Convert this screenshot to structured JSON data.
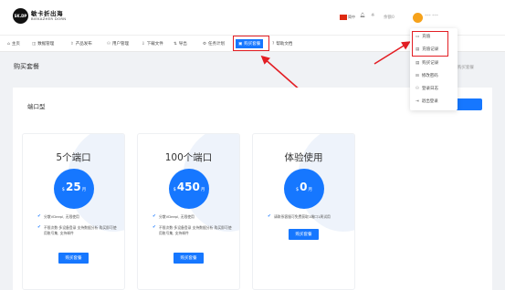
{
  "brand": {
    "logo_mark": "SK.DP",
    "name_cn": "敏卡折出海",
    "name_en": "BIEKAZHER DORN"
  },
  "header_tools": {
    "flag_label": "简中",
    "bell_icon": "bell-icon",
    "theme_icon": "brightness-icon",
    "account_text": "余额0",
    "username": "*** ***"
  },
  "nav": [
    {
      "icon": "⌂",
      "label": "主页"
    },
    {
      "icon": "◫",
      "label": "数据管理"
    },
    {
      "icon": "⇧",
      "label": "产品发布"
    },
    {
      "icon": "⚇",
      "label": "用户管理"
    },
    {
      "icon": "⇩",
      "label": "下载文件"
    },
    {
      "icon": "⇅",
      "label": "导出"
    },
    {
      "icon": "⚙",
      "label": "任务计划"
    },
    {
      "icon": "▣",
      "label": "购买套餐"
    },
    {
      "icon": "?",
      "label": "帮助文档"
    }
  ],
  "dropdown": [
    {
      "icon": "▭",
      "label": "充值"
    },
    {
      "icon": "▤",
      "label": "充值记录"
    },
    {
      "icon": "▤",
      "label": "购买记录"
    },
    {
      "icon": "⊟",
      "label": "修改密码"
    },
    {
      "icon": "⚇",
      "label": "登录日志"
    },
    {
      "icon": "⇥",
      "label": "退出登录"
    }
  ],
  "page": {
    "title": "购买套餐",
    "breadcrumb": "购买套餐"
  },
  "panel": {
    "title": "端口型"
  },
  "plans": [
    {
      "title": "5个端口",
      "currency": "$",
      "price": "25",
      "unit": "月",
      "features": [
        "分散VDeepl, 无限使用",
        "不限次数·多设备登录 支持数据分析 购买即可使用账号集, 支持邮件"
      ],
      "button": "购买套餐"
    },
    {
      "title": "100个端口",
      "currency": "$",
      "price": "450",
      "unit": "月",
      "features": [
        "分散VDeepl, 无限使用",
        "不限次数·多设备登录 支持数据分析 购买即可使用账号集, 支持邮件"
      ],
      "button": "购买套餐"
    },
    {
      "title": "体验使用",
      "currency": "$",
      "price": "0",
      "unit": "月",
      "features": [
        "请联系客服可免费获取1端口1周试用"
      ],
      "button": "购买套餐"
    }
  ],
  "colors": {
    "primary": "#1677ff",
    "highlight": "#e31e24"
  }
}
